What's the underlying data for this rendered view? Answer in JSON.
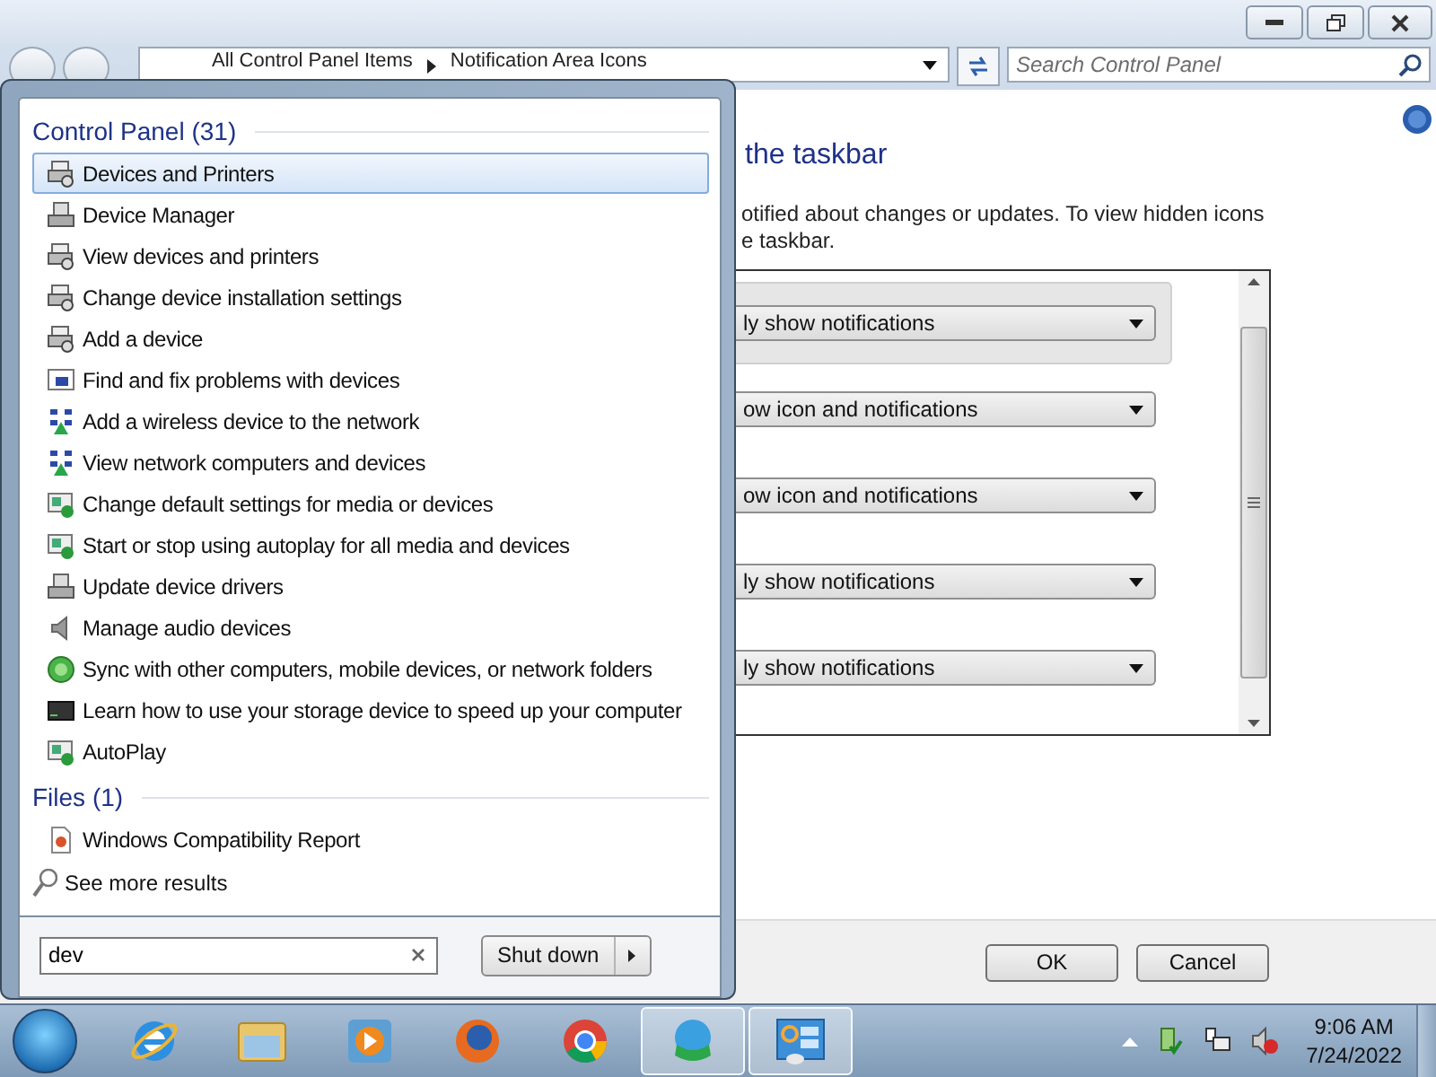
{
  "window": {
    "breadcrumb": [
      "All Control Panel Items",
      "Notification Area Icons"
    ],
    "search_placeholder": "Search Control Panel",
    "heading": "the taskbar",
    "description": [
      "otified about changes or updates. To view hidden icons",
      "e taskbar."
    ],
    "rows": [
      {
        "behavior": "ly show notifications",
        "selected": true
      },
      {
        "behavior": "ow icon and notifications",
        "selected": false
      },
      {
        "behavior": "ow icon and notifications",
        "selected": false
      },
      {
        "behavior": "ly show notifications",
        "selected": false
      },
      {
        "behavior": "ly show notifications",
        "selected": false
      }
    ],
    "buttons": [
      "OK",
      "Cancel"
    ]
  },
  "start_menu": {
    "groups": [
      {
        "title": "Control Panel (31)",
        "items": [
          {
            "label": "Devices and Printers",
            "kind": "printer",
            "selected": true
          },
          {
            "label": "Device Manager",
            "kind": "manager",
            "selected": false
          },
          {
            "label": "View devices and printers",
            "kind": "printer",
            "selected": false
          },
          {
            "label": "Change device installation settings",
            "kind": "printer",
            "selected": false
          },
          {
            "label": "Add a device",
            "kind": "printer",
            "selected": false
          },
          {
            "label": "Find and fix problems with devices",
            "kind": "troubleshoot",
            "selected": false
          },
          {
            "label": "Add a wireless device to the network",
            "kind": "network",
            "selected": false
          },
          {
            "label": "View network computers and devices",
            "kind": "network",
            "selected": false
          },
          {
            "label": "Change default settings for media or devices",
            "kind": "media",
            "selected": false
          },
          {
            "label": "Start or stop using autoplay for all media and devices",
            "kind": "media",
            "selected": false
          },
          {
            "label": "Update device drivers",
            "kind": "manager",
            "selected": false
          },
          {
            "label": "Manage audio devices",
            "kind": "speaker",
            "selected": false
          },
          {
            "label": "Sync with other computers, mobile devices, or network folders",
            "kind": "sync",
            "selected": false
          },
          {
            "label": "Learn how to use your storage device to speed up your computer",
            "kind": "storage",
            "selected": false
          },
          {
            "label": "AutoPlay",
            "kind": "media",
            "selected": false
          }
        ]
      },
      {
        "title": "Files (1)",
        "items": [
          {
            "label": "Windows Compatibility Report",
            "kind": "document",
            "selected": false
          }
        ]
      }
    ],
    "see_more": "See more results",
    "search": {
      "value": "dev"
    },
    "shutdown": "Shut down"
  },
  "taskbar": {
    "apps": [
      {
        "kind": "ie",
        "active": false
      },
      {
        "kind": "folder",
        "active": false
      },
      {
        "kind": "player",
        "active": false
      },
      {
        "kind": "firefox",
        "active": false
      },
      {
        "kind": "chrome",
        "active": false
      },
      {
        "kind": "downloader",
        "active": true
      },
      {
        "kind": "control",
        "active": true
      }
    ],
    "tray": [
      {
        "kind": "flag"
      },
      {
        "kind": "network"
      },
      {
        "kind": "speaker-muted"
      }
    ],
    "clock": {
      "time": "9:06 AM",
      "date": "7/24/2022"
    }
  }
}
